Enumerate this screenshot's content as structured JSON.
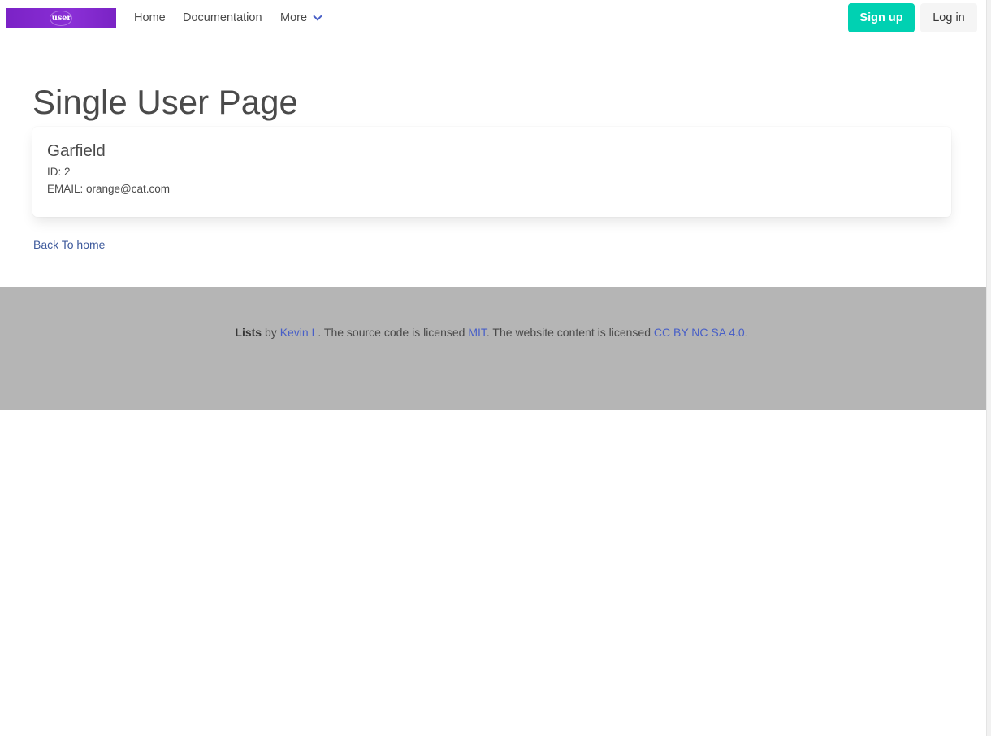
{
  "navbar": {
    "logo_text": "user",
    "links": [
      {
        "label": "Home"
      },
      {
        "label": "Documentation"
      },
      {
        "label": "More"
      }
    ],
    "signup_label": "Sign up",
    "login_label": "Log in"
  },
  "main": {
    "page_title": "Single User Page",
    "user": {
      "name": "Garfield",
      "id_label": "ID: ",
      "id_value": "2",
      "email_label": "EMAIL: ",
      "email_value": "orange@cat.com"
    },
    "back_link": "Back To home"
  },
  "footer": {
    "brand": "Lists",
    "by": " by ",
    "author": "Kevin L",
    "text1": ". The source code is licensed ",
    "license_code": "MIT",
    "text2": ". The website content is licensed ",
    "license_content": "CC BY NC SA 4.0",
    "text3": "."
  },
  "colors": {
    "logo_bg": "#7b22c6",
    "primary": "#00d1b2",
    "link": "#485fc7",
    "footer_bg": "#b5b5b5"
  }
}
